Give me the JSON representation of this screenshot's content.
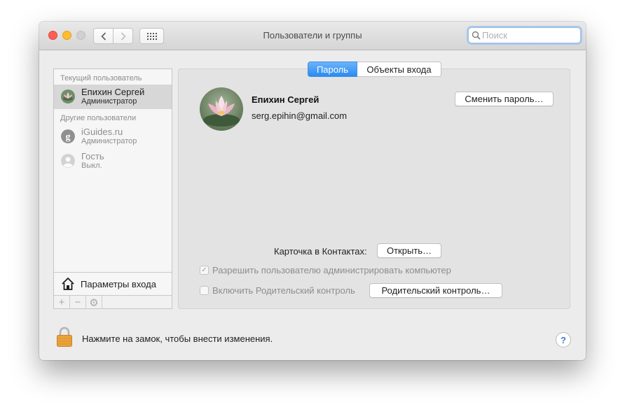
{
  "window": {
    "title": "Пользователи и группы"
  },
  "toolbar": {
    "search_placeholder": "Поиск",
    "back_icon": "chevron-left-icon",
    "forward_icon": "chevron-right-icon",
    "grid_icon": "show-all-grid-icon"
  },
  "sidebar": {
    "current_section": "Текущий пользователь",
    "current_user": {
      "name": "Епихин Сергей",
      "role": "Администратор"
    },
    "other_section": "Другие пользователи",
    "other_users": [
      {
        "name": "iGuides.ru",
        "role": "Администратор"
      },
      {
        "name": "Гость",
        "role": "Выкл."
      }
    ],
    "login_options": "Параметры входа",
    "bottom_bar": [
      "+",
      "−",
      "⚙"
    ]
  },
  "tabs": [
    {
      "label": "Пароль",
      "active": true
    },
    {
      "label": "Объекты входа",
      "active": false
    }
  ],
  "user": {
    "name": "Епихин Сергей",
    "email": "serg.epihin@gmail.com"
  },
  "buttons": {
    "change_password": "Сменить пароль…",
    "open": "Открыть…",
    "parental": "Родительский контроль…"
  },
  "contacts_card_label": "Карточка в Контактах:",
  "checkboxes": {
    "allow_admin": {
      "label": "Разрешить пользователю администрировать компьютер",
      "checked": true
    },
    "parental_control": {
      "label": "Включить Родительский контроль",
      "checked": false
    }
  },
  "footer": {
    "lock_text": "Нажмите на замок, чтобы внести изменения.",
    "help": "?"
  },
  "colors": {
    "accent": "#2a8bf2",
    "lock": "#e8a23c"
  }
}
